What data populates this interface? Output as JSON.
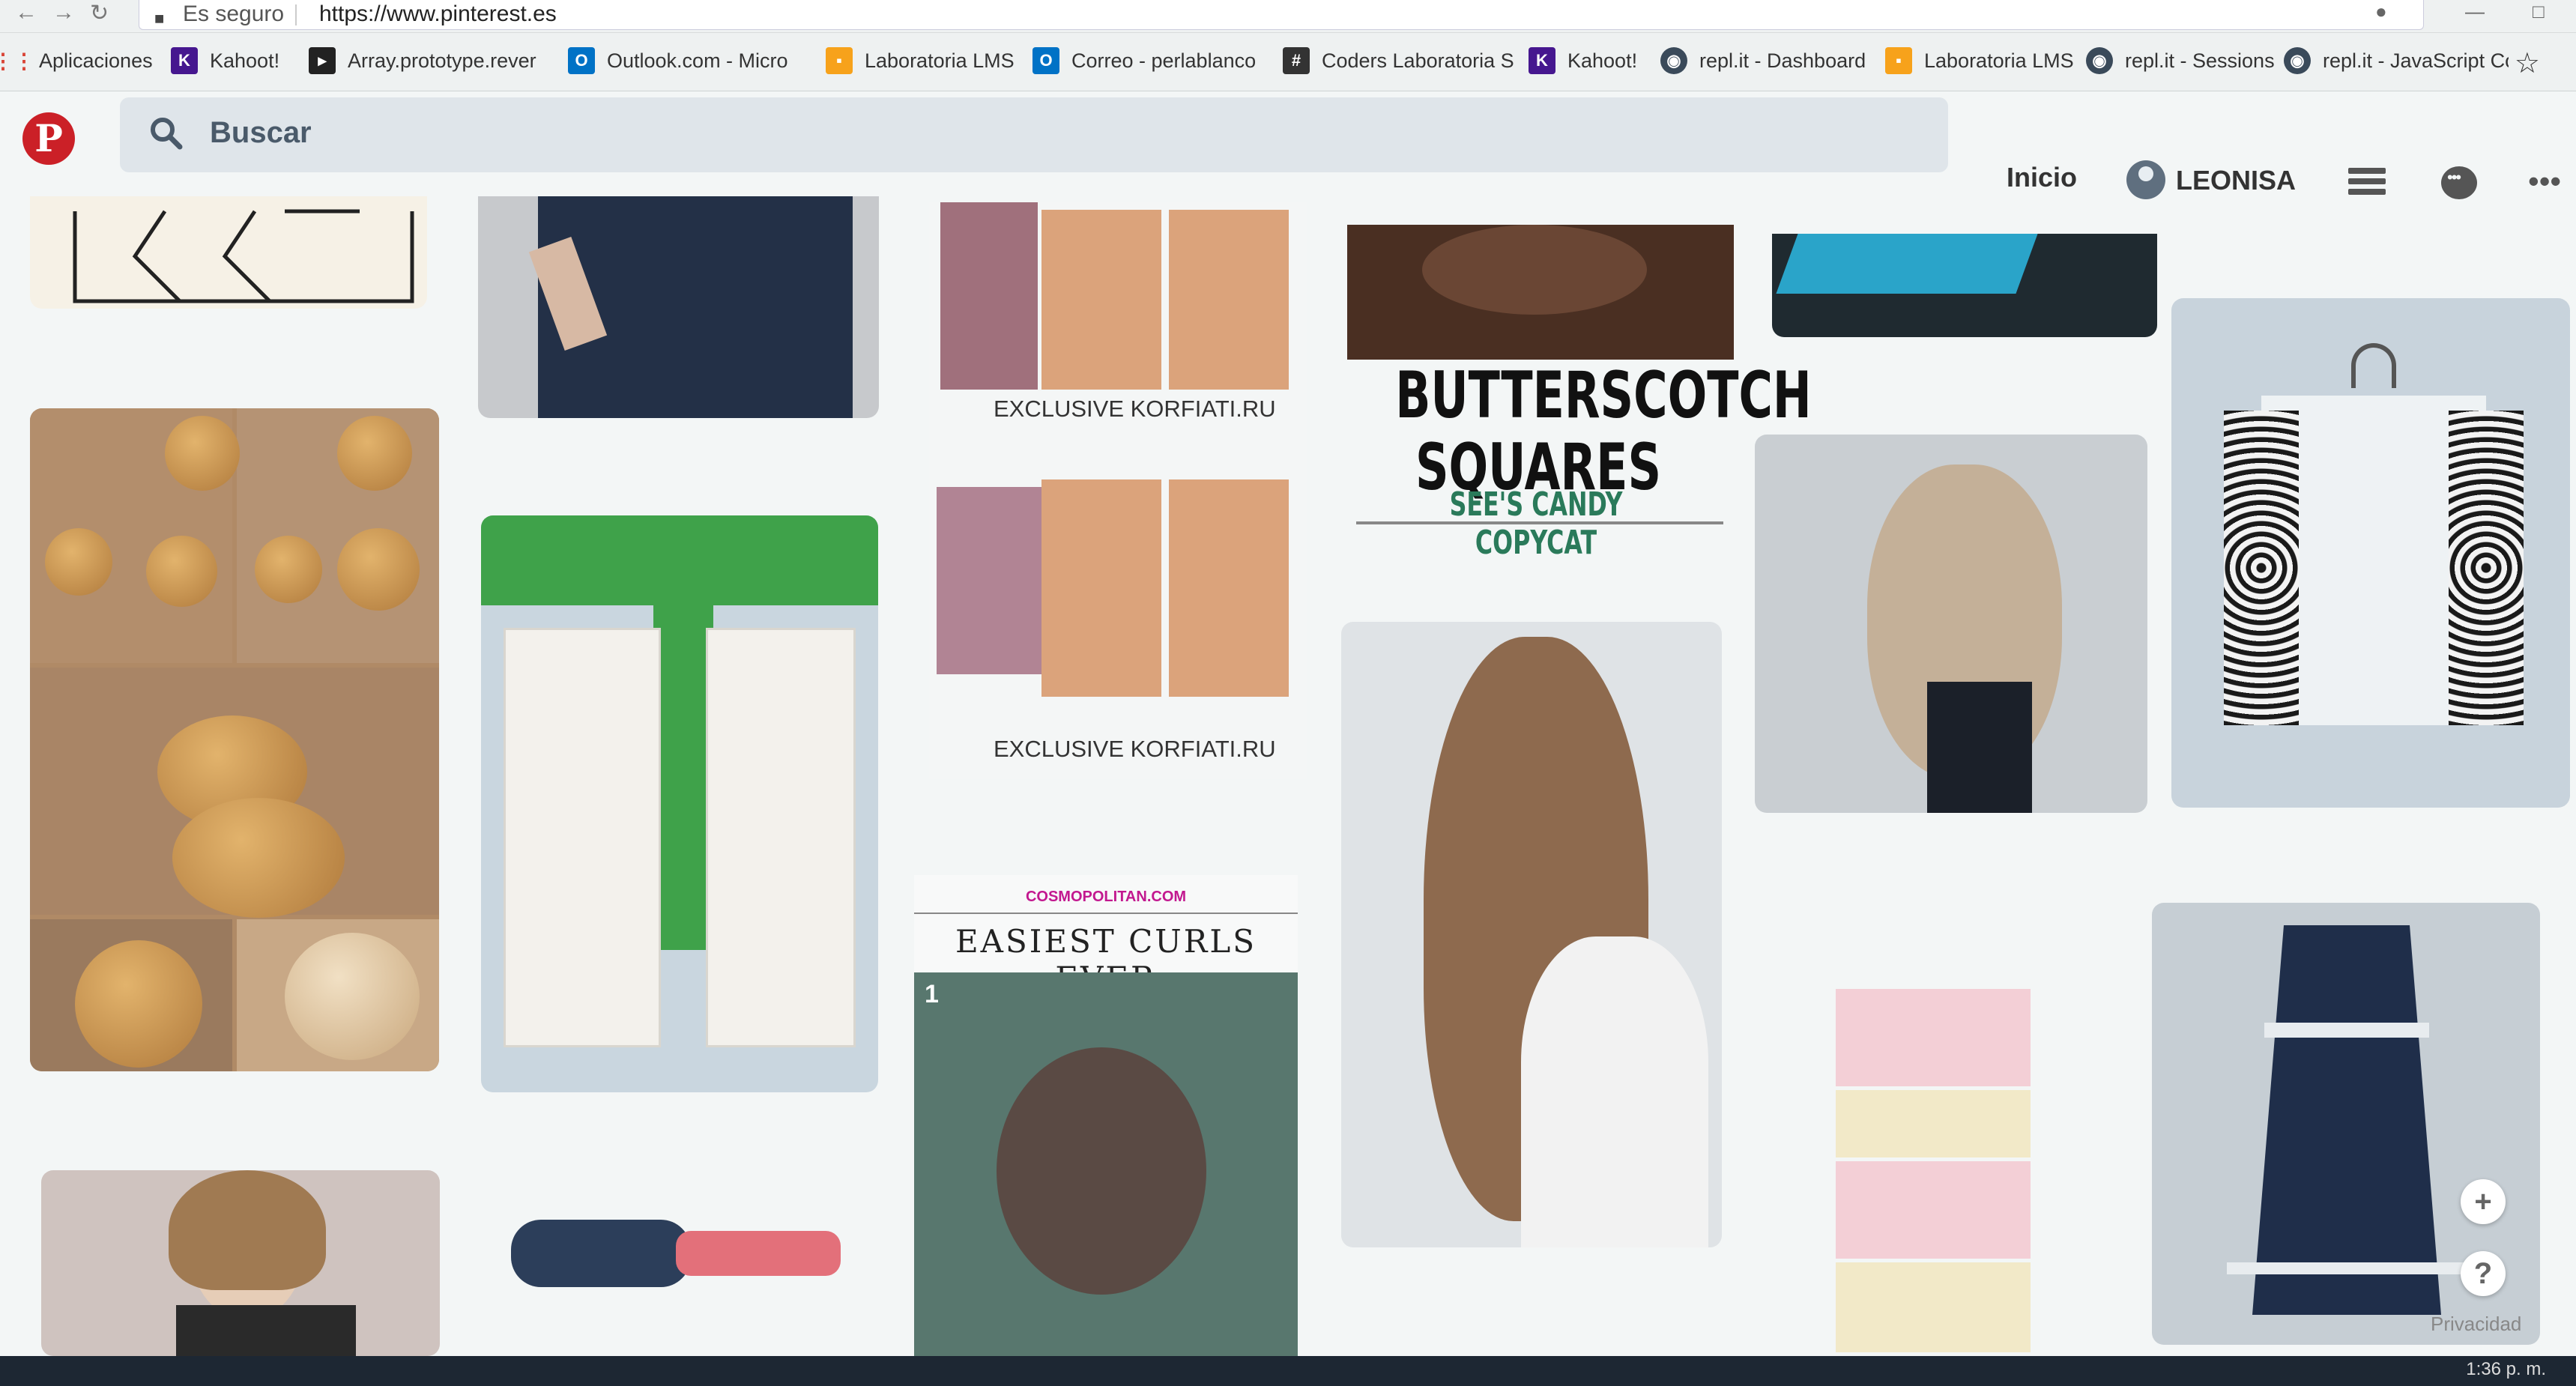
{
  "browser": {
    "secure_label": "Es seguro",
    "url": "https://www.pinterest.es",
    "bookmarks": [
      {
        "label": "Aplicaciones",
        "icon": "apps-grid-icon",
        "color": "#d94436"
      },
      {
        "label": "Kahoot!",
        "icon": "kahoot-icon",
        "color": "#46178f"
      },
      {
        "label": "Array.prototype.rever",
        "icon": "mdn-icon",
        "color": "#222222"
      },
      {
        "label": "Outlook.com - Micro",
        "icon": "outlook-icon",
        "color": "#0072c6"
      },
      {
        "label": "Laboratoria LMS",
        "icon": "laboratoria-icon",
        "color": "#f7a21b"
      },
      {
        "label": "Correo - perlablanco",
        "icon": "outlook-icon",
        "color": "#0072c6"
      },
      {
        "label": "Coders Laboratoria S",
        "icon": "slack-icon",
        "color": "#333333"
      },
      {
        "label": "Kahoot!",
        "icon": "kahoot-icon",
        "color": "#46178f"
      },
      {
        "label": "repl.it - Dashboard",
        "icon": "replit-icon",
        "color": "#3a4a5a"
      },
      {
        "label": "Laboratoria LMS",
        "icon": "laboratoria-icon",
        "color": "#f7a21b"
      },
      {
        "label": "repl.it - Sessions",
        "icon": "replit-icon",
        "color": "#3a4a5a"
      },
      {
        "label": "repl.it - JavaScript Co",
        "icon": "replit-icon",
        "color": "#3a4a5a"
      }
    ]
  },
  "header": {
    "logo": "P",
    "search_placeholder": "Buscar",
    "home_label": "Inicio",
    "user_name": "LEONISA"
  },
  "pins": {
    "butterscotch_title_1": "BUTTERSCOTCH",
    "butterscotch_title_2": "SQUARES",
    "butterscotch_sub": "SEE'S CANDY COPYCAT",
    "korfiati_1": "EXCLUSIVE KORFIATI.RU",
    "korfiati_2": "EXCLUSIVE KORFIATI.RU",
    "cosmo_source": "COSMOPOLITAN.COM",
    "cosmo_title": "EASIEST CURLS EVER",
    "cosmo_step": "1"
  },
  "floating": {
    "add": "+",
    "help": "?",
    "privacy": "Privacidad"
  },
  "taskbar": {
    "clock": "1:36 p. m."
  },
  "colors": {
    "pinterest_red": "#cb2027",
    "search_bg": "#dfe5ea",
    "page_bg": "#f3f6f6"
  }
}
